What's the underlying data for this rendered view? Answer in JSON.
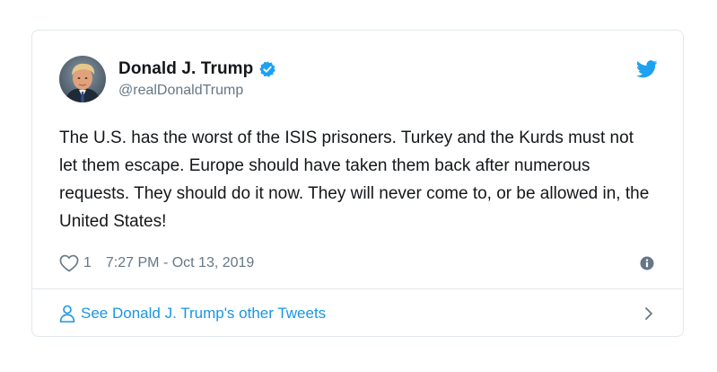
{
  "tweet": {
    "author": {
      "display_name": "Donald J. Trump",
      "handle": "@realDonaldTrump",
      "verified": true
    },
    "text": "The U.S. has the worst of the ISIS prisoners. Turkey and the Kurds must not let them escape. Europe should have taken them back after numerous requests. They should do it now. They will never come to, or be allowed in, the United States!",
    "like_count": "1",
    "timestamp": "7:27 PM - Oct 13, 2019"
  },
  "footer": {
    "label": "See Donald J. Trump's other Tweets"
  },
  "icons": {
    "brand": "twitter-bird-icon",
    "verified": "verified-badge-icon",
    "like": "heart-icon",
    "info": "info-icon",
    "profile": "person-icon",
    "navigate": "chevron-right-icon"
  },
  "colors": {
    "brand_blue": "#1da1f2",
    "link_blue": "#1b95e0",
    "text_primary": "#14171a",
    "text_secondary": "#657786",
    "border": "#e1e8ed"
  }
}
